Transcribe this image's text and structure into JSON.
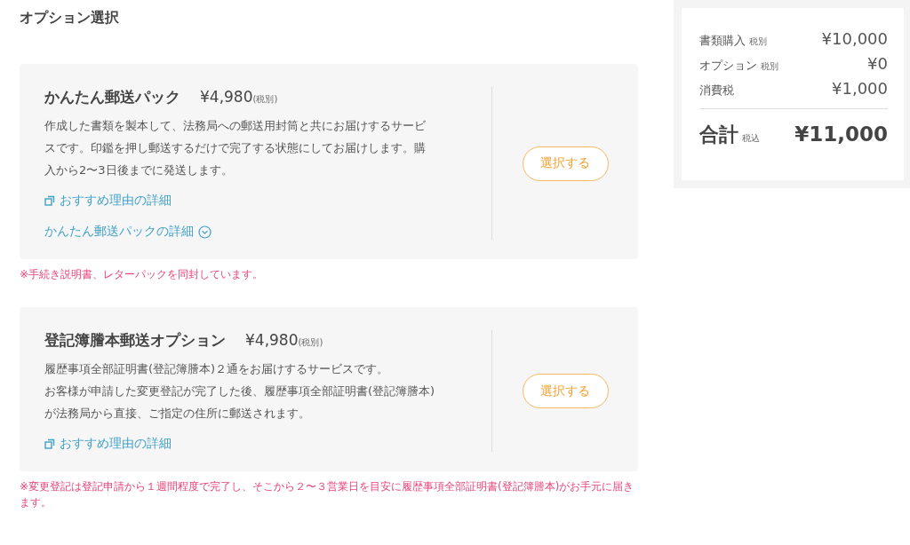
{
  "heading": "オプション選択",
  "options": [
    {
      "title": "かんたん郵送パック",
      "price": "¥4,980",
      "tax_note": "(税別)",
      "description": [
        "作成した書類を製本して、法務局への郵送用封筒と共にお届けするサービ",
        "スです。印鑑を押し郵送するだけで完了する状態にしてお届けします。購",
        "入から2〜3日後までに発送します。"
      ],
      "links": [
        {
          "kind": "external",
          "label": "おすすめ理由の詳細"
        },
        {
          "kind": "expand",
          "label": "かんたん郵送パックの詳細"
        }
      ],
      "button": "選択する",
      "note": "※手続き説明書、レターパックを同封しています。"
    },
    {
      "title": "登記簿謄本郵送オプション",
      "price": "¥4,980",
      "tax_note": "(税別)",
      "description": [
        "履歴事項全部証明書(登記簿謄本)２通をお届けするサービスです。",
        "お客様が申請した変更登記が完了した後、履歴事項全部証明書(登記簿謄本)",
        "が法務局から直接、ご指定の住所に郵送されます。"
      ],
      "links": [
        {
          "kind": "external",
          "label": "おすすめ理由の詳細"
        }
      ],
      "button": "選択する",
      "note": "※変更登記は登記申請から１週間程度で完了し、そこから２〜３営業日を目安に履歴事項全部証明書(登記簿謄本)がお手元に届きます。"
    }
  ],
  "summary": {
    "rows": [
      {
        "label": "書類購入",
        "tax_note": "税別",
        "amount": "¥10,000"
      },
      {
        "label": "オプション",
        "tax_note": "税別",
        "amount": "¥0"
      },
      {
        "label": "消費税",
        "amount": "¥1,000"
      }
    ],
    "total": {
      "label": "合計",
      "tax_note": "税込",
      "amount": "¥11,000"
    }
  }
}
